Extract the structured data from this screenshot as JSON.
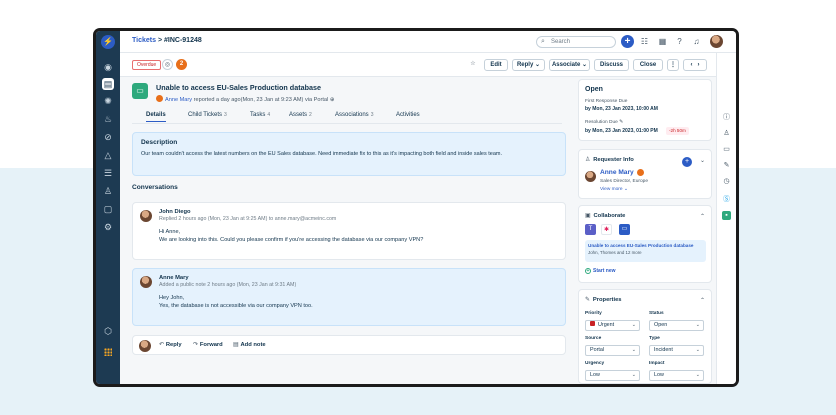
{
  "breadcrumb": {
    "section": "Tickets",
    "separator": ">",
    "ticket_id": "#INC-91248"
  },
  "topbar": {
    "search_placeholder": "Search",
    "plus_label": "+"
  },
  "actions": {
    "overdue_badge": "Overdue",
    "watchers_count": "2",
    "edit": "Edit",
    "reply": "Reply",
    "associate": "Associate",
    "discuss": "Discuss",
    "close": "Close",
    "more": "⋮",
    "prev": "‹",
    "next": "›"
  },
  "ticket": {
    "title": "Unable to access EU-Sales Production database",
    "requester": "Anne Mary",
    "meta": "reported a day ago(Mon, 23 Jan at 9:23 AM) via Portal"
  },
  "tabs": [
    {
      "label": "Details",
      "count": ""
    },
    {
      "label": "Child Tickets",
      "count": "3"
    },
    {
      "label": "Tasks",
      "count": "4"
    },
    {
      "label": "Assets",
      "count": "2"
    },
    {
      "label": "Associations",
      "count": "3"
    },
    {
      "label": "Activities",
      "count": ""
    }
  ],
  "description": {
    "heading": "Description",
    "text": "Our team couldn't access the latest numbers on the EU Sales database. Need immediate fix to this as it's impacting both field and inside sales team."
  },
  "conversations": {
    "heading": "Conversations",
    "messages": [
      {
        "name": "John Diego",
        "sub": "Replied 2 hours ago (Mon, 23 Jan at 9:25 AM) to anne.mary@acmeinc.com",
        "line1": "Hi Anne,",
        "line2": "We are looking into this. Could you please confirm if you're accessing the database via our company VPN?"
      },
      {
        "name": "Anne Mary",
        "sub": "Added a public note 2 hours ago (Mon, 23 Jan at 9:31 AM)",
        "line1": "Hey John,",
        "line2": "Yes, the database is not accessible via our company VPN too."
      }
    ]
  },
  "replybar": {
    "reply": "Reply",
    "forward": "Forward",
    "add_note": "Add note"
  },
  "status_card": {
    "status": "Open",
    "first_response_label": "First Response Due",
    "first_response_value": "by Mon, 23 Jan 2023, 10:00 AM",
    "resolution_label": "Resolution Due",
    "resolution_value": "by Mon, 23 Jan 2023, 01:00 PM",
    "overdue_tag": "-2h 50m"
  },
  "requester_info": {
    "heading": "Requester Info",
    "name": "Anne Mary",
    "role": "Sales Director, Europe",
    "view_more": "View more"
  },
  "collaborate": {
    "heading": "Collaborate",
    "item_title": "Unable to access EU-Sales Production database",
    "item_sub": "John, Thomes and 12 more",
    "start_new": "Start new"
  },
  "properties": {
    "heading": "Properties",
    "fields": [
      {
        "label": "Priority",
        "value": "Urgent"
      },
      {
        "label": "Status",
        "value": "Open"
      },
      {
        "label": "Source",
        "value": "Portal"
      },
      {
        "label": "Type",
        "value": "Incident"
      },
      {
        "label": "Urgency",
        "value": "Low"
      },
      {
        "label": "Impact",
        "value": "Low"
      }
    ]
  },
  "colors": {
    "primary": "#2c5cc5",
    "nav": "#1d3a52",
    "urgent": "#c82124",
    "accent_orange": "#e86f1a",
    "green": "#2ea97d",
    "background_band": "#e6f2f8"
  }
}
